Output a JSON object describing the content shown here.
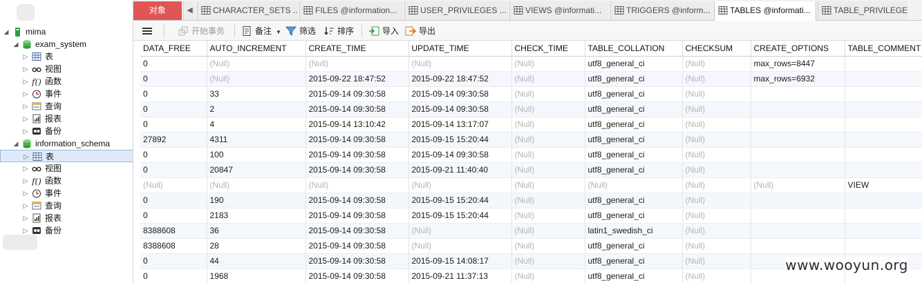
{
  "tree": {
    "nodes": [
      {
        "label": "mima",
        "icon": "connection-icon",
        "kind": "connection",
        "expanded": true
      },
      {
        "label": "exam_system",
        "icon": "database-icon",
        "kind": "database",
        "expanded": true
      },
      {
        "label": "表",
        "icon": "table-icon"
      },
      {
        "label": "视图",
        "icon": "view-icon"
      },
      {
        "label": "函数",
        "icon": "function-icon"
      },
      {
        "label": "事件",
        "icon": "event-icon"
      },
      {
        "label": "查询",
        "icon": "query-icon"
      },
      {
        "label": "报表",
        "icon": "report-icon"
      },
      {
        "label": "备份",
        "icon": "backup-icon"
      },
      {
        "label": "information_schema",
        "icon": "database-icon",
        "kind": "database",
        "expanded": true
      },
      {
        "label": "表",
        "icon": "table-icon",
        "selected": true
      },
      {
        "label": "视图",
        "icon": "view-icon"
      },
      {
        "label": "函数",
        "icon": "function-icon"
      },
      {
        "label": "事件",
        "icon": "event-icon"
      },
      {
        "label": "查询",
        "icon": "query-icon"
      },
      {
        "label": "报表",
        "icon": "report-icon"
      },
      {
        "label": "备份",
        "icon": "backup-icon"
      }
    ]
  },
  "tabs": {
    "object_label": "对象",
    "items": [
      {
        "label": "CHARACTER_SETS ..."
      },
      {
        "label": "FILES @information..."
      },
      {
        "label": "USER_PRIVILEGES ..."
      },
      {
        "label": "VIEWS @informati..."
      },
      {
        "label": "TRIGGERS @inform..."
      },
      {
        "label": "TABLES @informati...",
        "active": true
      },
      {
        "label": "TABLE_PRIVILEGES"
      }
    ]
  },
  "toolbar": {
    "begin_transaction": "开始事务",
    "note": "备注",
    "filter": "筛选",
    "sort": "排序",
    "import": "导入",
    "export": "导出"
  },
  "grid": {
    "columns": [
      "DATA_FREE",
      "AUTO_INCREMENT",
      "CREATE_TIME",
      "UPDATE_TIME",
      "CHECK_TIME",
      "TABLE_COLLATION",
      "CHECKSUM",
      "CREATE_OPTIONS",
      "TABLE_COMMENT"
    ],
    "null_text": "(Null)",
    "rows": [
      [
        "0",
        null,
        null,
        null,
        null,
        "utf8_general_ci",
        null,
        "max_rows=8447",
        ""
      ],
      [
        "0",
        null,
        "2015-09-22 18:47:52",
        "2015-09-22 18:47:52",
        null,
        "utf8_general_ci",
        null,
        "max_rows=6932",
        ""
      ],
      [
        "0",
        "33",
        "2015-09-14 09:30:58",
        "2015-09-14 09:30:58",
        null,
        "utf8_general_ci",
        null,
        "",
        ""
      ],
      [
        "0",
        "2",
        "2015-09-14 09:30:58",
        "2015-09-14 09:30:58",
        null,
        "utf8_general_ci",
        null,
        "",
        ""
      ],
      [
        "0",
        "4",
        "2015-09-14 13:10:42",
        "2015-09-14 13:17:07",
        null,
        "utf8_general_ci",
        null,
        "",
        ""
      ],
      [
        "27892",
        "4311",
        "2015-09-14 09:30:58",
        "2015-09-15 15:20:44",
        null,
        "utf8_general_ci",
        null,
        "",
        ""
      ],
      [
        "0",
        "100",
        "2015-09-14 09:30:58",
        "2015-09-14 09:30:58",
        null,
        "utf8_general_ci",
        null,
        "",
        ""
      ],
      [
        "0",
        "20847",
        "2015-09-14 09:30:58",
        "2015-09-21 11:40:40",
        null,
        "utf8_general_ci",
        null,
        "",
        ""
      ],
      [
        null,
        null,
        null,
        null,
        null,
        null,
        null,
        null,
        "VIEW"
      ],
      [
        "0",
        "190",
        "2015-09-14 09:30:58",
        "2015-09-15 15:20:44",
        null,
        "utf8_general_ci",
        null,
        "",
        ""
      ],
      [
        "0",
        "2183",
        "2015-09-14 09:30:58",
        "2015-09-15 15:20:44",
        null,
        "utf8_general_ci",
        null,
        "",
        ""
      ],
      [
        "8388608",
        "36",
        "2015-09-14 09:30:58",
        null,
        null,
        "latin1_swedish_ci",
        null,
        "",
        ""
      ],
      [
        "8388608",
        "28",
        "2015-09-14 09:30:58",
        null,
        null,
        "utf8_general_ci",
        null,
        "",
        ""
      ],
      [
        "0",
        "44",
        "2015-09-14 09:30:58",
        "2015-09-15 14:08:17",
        null,
        "utf8_general_ci",
        null,
        "",
        ""
      ],
      [
        "0",
        "1968",
        "2015-09-14 09:30:58",
        "2015-09-21 11:37:13",
        null,
        "utf8_general_ci",
        null,
        "",
        ""
      ]
    ]
  },
  "watermark": "www.wooyun.org",
  "colors": {
    "object_tab": "#e15555",
    "selected_row": "#dfeaf8",
    "alt_row": "#f4f8fd",
    "null_text": "#b4b4b4"
  }
}
